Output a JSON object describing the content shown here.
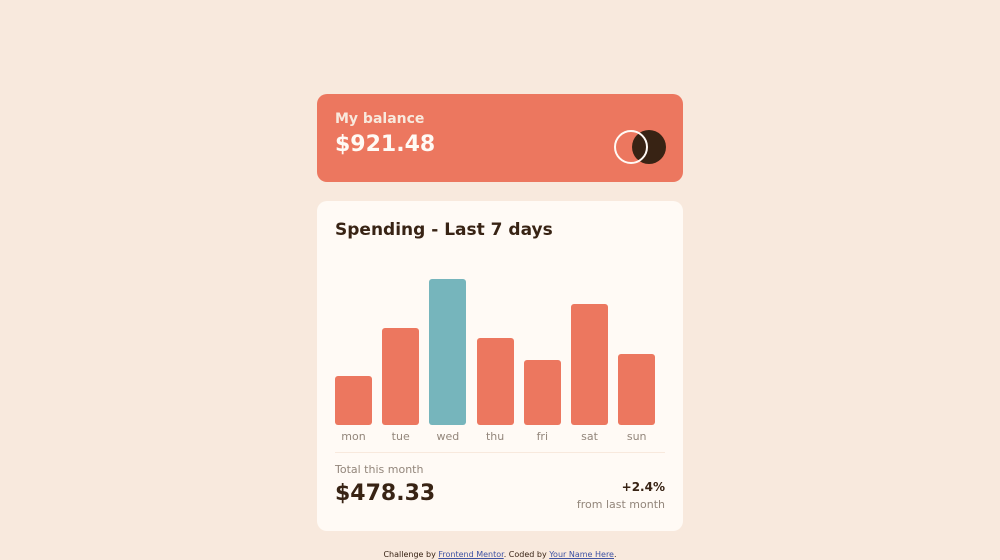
{
  "balance": {
    "label": "My balance",
    "amount": "$921.48",
    "logo_icon": "two-circles-logo"
  },
  "spending": {
    "title": "Spending - Last 7 days",
    "total_label": "Total this month",
    "total_amount": "$478.33",
    "change_percent": "+2.4%",
    "change_label": "from last month"
  },
  "chart_data": {
    "type": "bar",
    "categories": [
      "mon",
      "tue",
      "wed",
      "thu",
      "fri",
      "sat",
      "sun"
    ],
    "values": [
      17.45,
      34.91,
      52.36,
      31.07,
      23.39,
      43.28,
      25.48
    ],
    "highlight_index": 2,
    "title": "",
    "xlabel": "",
    "ylabel": "",
    "ylim": [
      0,
      52.36
    ],
    "grid": false,
    "colors": {
      "default": "#ec775f",
      "highlight": "#76b5bc"
    }
  },
  "footer": {
    "prefix": "Challenge by ",
    "link1": "Frontend Mentor",
    "middle": ". Coded by ",
    "link2": "Your Name Here",
    "suffix": "."
  }
}
